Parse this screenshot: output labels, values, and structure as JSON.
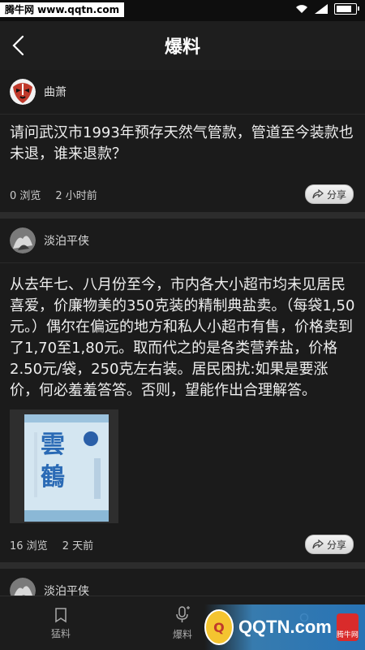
{
  "status_bar": {
    "watermark": "腾牛网 www.qqtn.com",
    "time": ""
  },
  "header": {
    "title": "爆料"
  },
  "posts": [
    {
      "username": "曲萧",
      "text": "请问武汉市1993年预存天然气管款，管道至今装款也未退，谁来退款？",
      "views": "0 浏览",
      "time": "2 小时前",
      "share_label": "分享"
    },
    {
      "username": "淡泊平侠",
      "text": "从去年七、八月份至今，市内各大小超市均未见居民喜爱，价廉物美的350克装的精制典盐卖。（每袋1,50元。）偶尔在偏远的地方和私人小超市有售，价格卖到了1,70至1,80元。取而代之的是各类营养盐，价格2.50元/袋，250克左右装。居民困扰:如果是要涨价，何必羞羞答答。否则，望能作出合理解答。",
      "image_label": "雲鶴",
      "views": "16 浏览",
      "time": "2 天前",
      "share_label": "分享"
    },
    {
      "username": "淡泊平侠"
    }
  ],
  "tabs": [
    {
      "label": "猛料",
      "icon": "bookmark-icon"
    },
    {
      "label": "爆料",
      "icon": "microphone-icon"
    },
    {
      "label": "",
      "icon": "person-icon"
    }
  ],
  "watermark_bottom": {
    "text": "QQTN.com",
    "badge": "腾牛网",
    "logo_char": "Q"
  }
}
